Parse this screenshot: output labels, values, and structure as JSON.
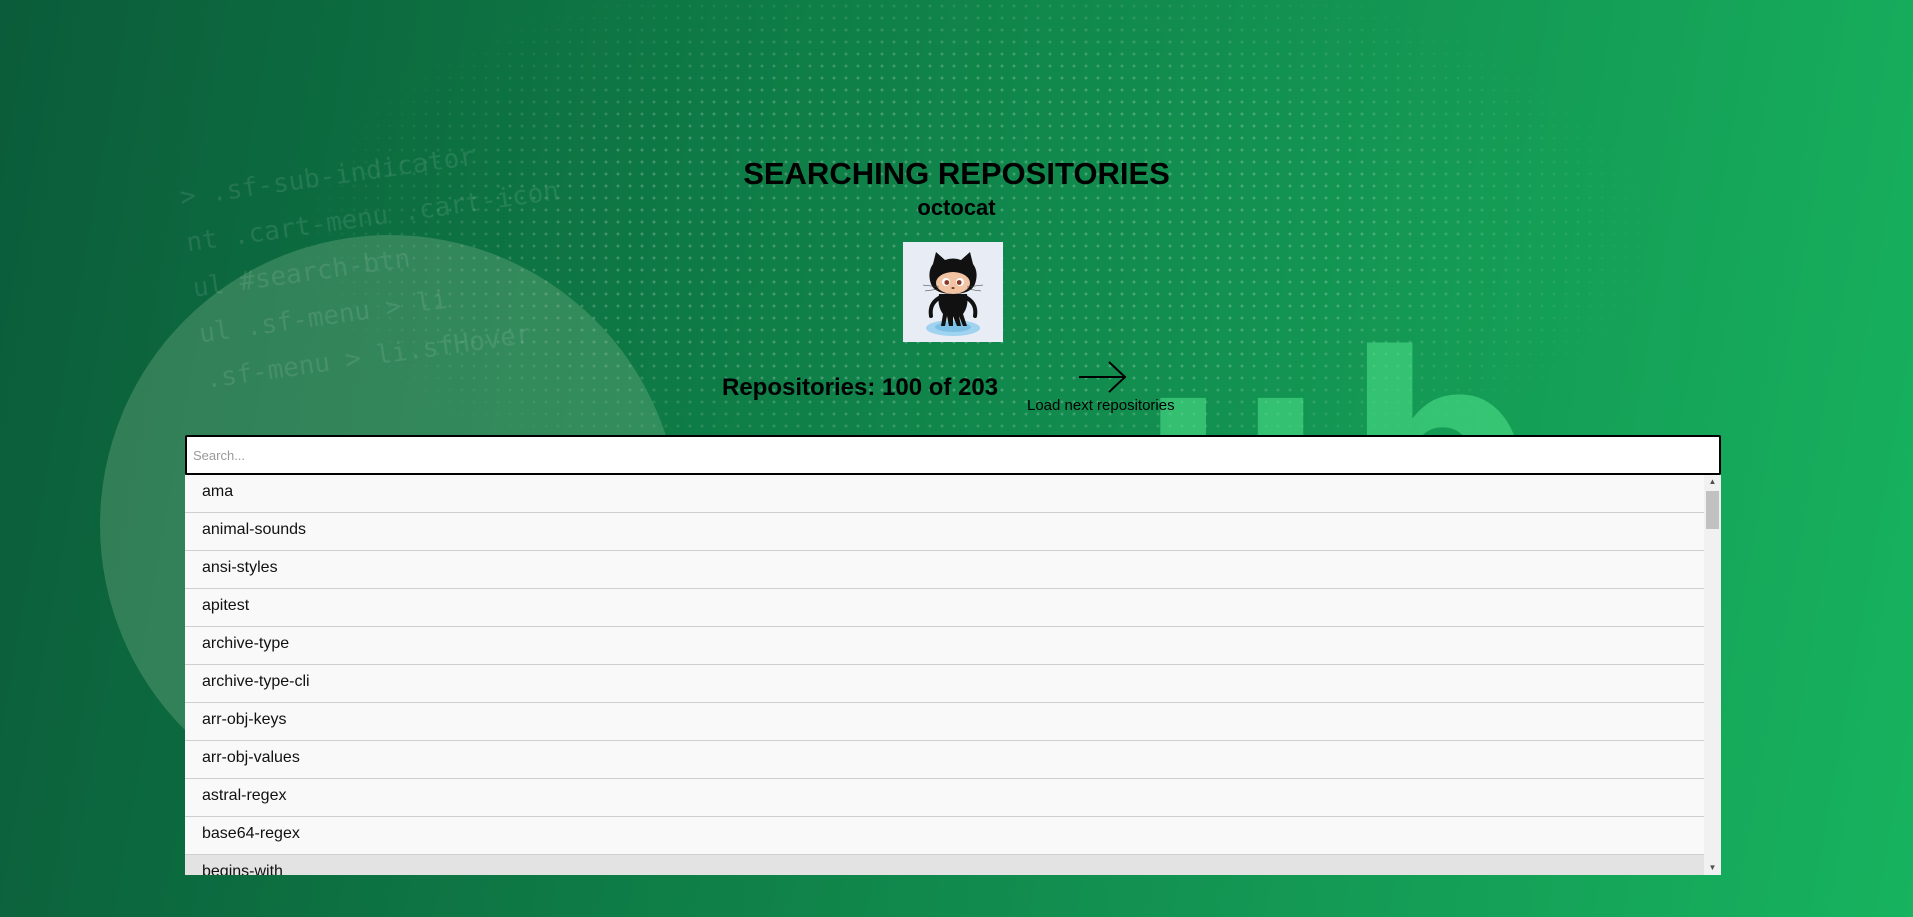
{
  "header": {
    "title": "SEARCHING REPOSITORIES",
    "username": "octocat"
  },
  "repo_count": {
    "label": "Repositories: 100 of 203"
  },
  "load_next": {
    "label": "Load next repositories",
    "icon": "arrow-right-icon"
  },
  "search": {
    "placeholder": "Search...",
    "value": ""
  },
  "repositories": [
    "ama",
    "animal-sounds",
    "ansi-styles",
    "apitest",
    "archive-type",
    "archive-type-cli",
    "arr-obj-keys",
    "arr-obj-values",
    "astral-regex",
    "base64-regex",
    "begins-with"
  ],
  "background": {
    "watermark_letters": "ub"
  },
  "colors": {
    "background_dark": "#0b5c3a",
    "background_light": "#17b35f",
    "list_background": "#f9f9f9",
    "list_hover": "#e3e3e3"
  }
}
